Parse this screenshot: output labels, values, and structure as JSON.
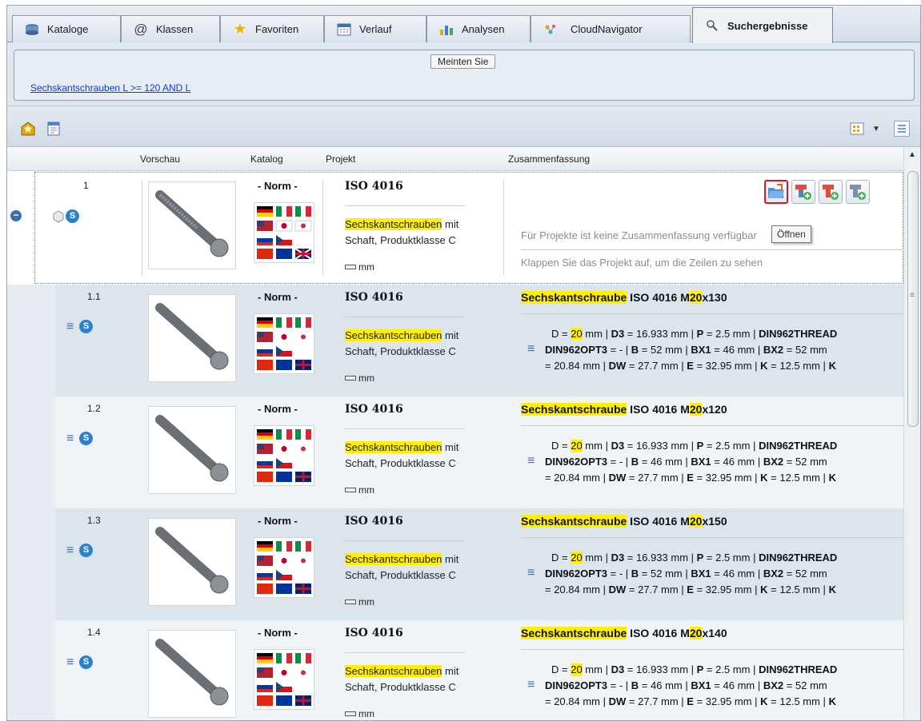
{
  "tabs": [
    {
      "label": "Kataloge",
      "icon": "catalog-icon"
    },
    {
      "label": "Klassen",
      "icon": "at-sign-icon"
    },
    {
      "label": "Favoriten",
      "icon": "star-icon"
    },
    {
      "label": "Verlauf",
      "icon": "calendar-icon"
    },
    {
      "label": "Analysen",
      "icon": "bar-chart-icon"
    },
    {
      "label": "CloudNavigator",
      "icon": "cloud-navigator-icon"
    },
    {
      "label": "Suchergebnisse",
      "icon": "search-icon",
      "active": true
    }
  ],
  "meinten": {
    "title": "Meinten Sie",
    "suggestion": "Sechskantschrauben L >= 120 AND L"
  },
  "columns": {
    "vorschau": "Vorschau",
    "katalog": "Katalog",
    "projekt": "Projekt",
    "zusammenfassung": "Zusammenfassung"
  },
  "tooltip": "Öffnen",
  "parent": {
    "number": "1",
    "katalog": "- Norm -",
    "projekt": "ISO 4016",
    "desc_hl": "Sechskantschrauben",
    "desc_rest1": " mit",
    "desc_line2": "Schaft, Produktklasse C",
    "unit": "mm",
    "summary1": "Für Projekte ist keine Zusammenfassung verfügbar",
    "summary2": "Klappen Sie das Projekt auf, um die Zeilen zu sehen"
  },
  "rows": [
    {
      "number": "1.1",
      "katalog": "- Norm -",
      "projekt": "ISO 4016",
      "desc_hl": "Sechskantschrauben",
      "desc_rest1": " mit",
      "desc_line2": "Schaft, Produktklasse C",
      "unit": "mm",
      "title_hl": "Sechskantschraube",
      "title_mid": " ISO 4016 M",
      "title_hl2": "20",
      "title_end": "x130",
      "bx1": "46",
      "bx2": "52"
    },
    {
      "number": "1.2",
      "katalog": "- Norm -",
      "projekt": "ISO 4016",
      "desc_hl": "Sechskantschrauben",
      "desc_rest1": " mit",
      "desc_line2": "Schaft, Produktklasse C",
      "unit": "mm",
      "title_hl": "Sechskantschraube",
      "title_mid": " ISO 4016 M",
      "title_hl2": "20",
      "title_end": "x120",
      "bx1": "46",
      "bx2": "52"
    },
    {
      "number": "1.3",
      "katalog": "- Norm -",
      "projekt": "ISO 4016",
      "desc_hl": "Sechskantschrauben",
      "desc_rest1": " mit",
      "desc_line2": "Schaft, Produktklasse C",
      "unit": "mm",
      "title_hl": "Sechskantschraube",
      "title_mid": " ISO 4016 M",
      "title_hl2": "20",
      "title_end": "x150",
      "bx1": "46",
      "bx2": "52"
    },
    {
      "number": "1.4",
      "katalog": "- Norm -",
      "projekt": "ISO 4016",
      "desc_hl": "Sechskantschrauben",
      "desc_rest1": " mit",
      "desc_line2": "Schaft, Produktklasse C",
      "unit": "mm",
      "title_hl": "Sechskantschraube",
      "title_mid": " ISO 4016 M",
      "title_hl2": "20",
      "title_end": "x140",
      "bx1": "46",
      "bx2": "52"
    }
  ],
  "row_b_values": [
    "52",
    "46",
    "52",
    "46"
  ],
  "summary": {
    "d_label": "D = ",
    "d_val": "20",
    "d_rest": " mm | ",
    "d3": "D3",
    "d3_rest": " = 16.933 mm | ",
    "p": "P",
    "p_rest": " = 2.5 mm | ",
    "thread": "DIN962THREAD",
    "opt3": "DIN962OPT3",
    "opt3_rest": " = - | ",
    "b": "B",
    "bx1": "BX1",
    "bx2": "BX2",
    "mm": " mm",
    "line3_start": "= 20.84 mm | ",
    "dw": "DW",
    "dw_rest": " = 27.7 mm | ",
    "e": "E",
    "e_rest": " = 32.95 mm | ",
    "k": "K",
    "k_rest": " = 12.5 mm | ",
    "k2": "K"
  },
  "colors": {
    "highlight": "#ffef00",
    "link": "#0b3bd4",
    "accent_red": "#e0141a",
    "row_alt": "#dde5ec"
  }
}
